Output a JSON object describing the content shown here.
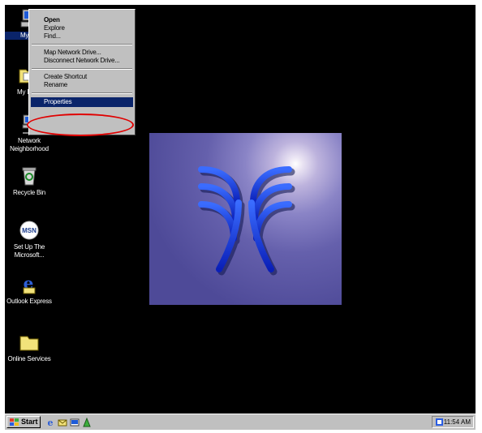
{
  "desktop": {
    "icons": [
      {
        "label": "My Co",
        "icon": "my-computer-icon",
        "selected": true
      },
      {
        "label": "My Doc",
        "icon": "my-documents-icon"
      },
      {
        "label": "Network Neighborhood",
        "icon": "network-neighborhood-icon"
      },
      {
        "label": "Recycle Bin",
        "icon": "recycle-bin-icon"
      },
      {
        "label": "Set Up The Microsoft...",
        "icon": "msn-icon"
      },
      {
        "label": "Outlook Express",
        "icon": "outlook-express-icon"
      },
      {
        "label": "Online Services",
        "icon": "folder-icon"
      }
    ]
  },
  "context_menu": {
    "items": [
      {
        "label": "Open",
        "bold": true
      },
      {
        "label": "Explore"
      },
      {
        "label": "Find..."
      },
      {
        "separator": true
      },
      {
        "label": "Map Network Drive..."
      },
      {
        "label": "Disconnect Network Drive..."
      },
      {
        "separator": true
      },
      {
        "label": "Create Shortcut"
      },
      {
        "label": "Rename"
      },
      {
        "separator": true
      },
      {
        "label": "Properties",
        "highlighted": true
      }
    ],
    "highlight_color": "#e00000"
  },
  "taskbar": {
    "start_label": "Start",
    "quick_launch": [
      "internet-explorer-icon",
      "outlook-icon",
      "desktop-icon",
      "channels-icon"
    ],
    "clock": "11:54 AM"
  },
  "colors": {
    "desktop_bg": "#000000",
    "selection": "#0a246a",
    "taskbar": "#c0c0c0"
  }
}
